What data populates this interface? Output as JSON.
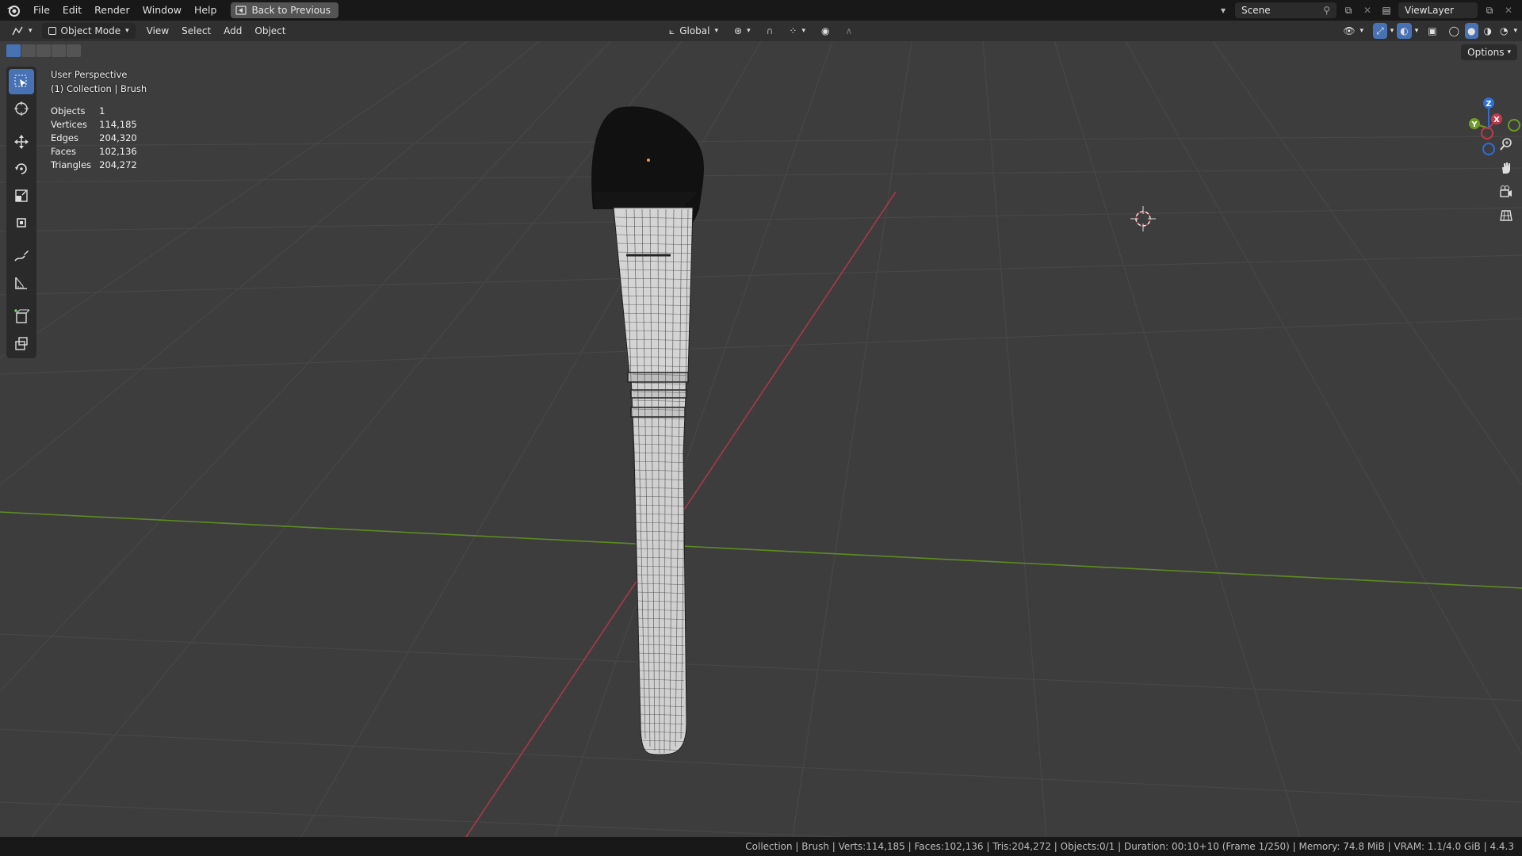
{
  "menubar": {
    "items": [
      "File",
      "Edit",
      "Render",
      "Window",
      "Help"
    ],
    "back_button": "Back to Previous",
    "scene": "Scene",
    "view_layer": "ViewLayer"
  },
  "header": {
    "mode": "Object Mode",
    "menus": [
      "View",
      "Select",
      "Add",
      "Object"
    ],
    "transform_orientation": "Global",
    "options": "Options"
  },
  "viewport": {
    "view_name": "User Perspective",
    "collection_label": "(1) Collection | Brush",
    "stats": [
      {
        "label": "Objects",
        "value": "1"
      },
      {
        "label": "Vertices",
        "value": "114,185"
      },
      {
        "label": "Edges",
        "value": "204,320"
      },
      {
        "label": "Faces",
        "value": "102,136"
      },
      {
        "label": "Triangles",
        "value": "204,272"
      }
    ],
    "gizmo_axes": {
      "x": "X",
      "y": "Y",
      "z": "Z"
    }
  },
  "statusbar": {
    "text": "Collection | Brush | Verts:114,185 | Faces:102,136 | Tris:204,272 | Objects:0/1 | Duration: 00:10+10 (Frame 1/250) | Memory: 74.8 MiB | VRAM: 1.1/4.0 GiB | 4.4.3"
  },
  "colors": {
    "accent": "#4772b3",
    "x_axis": "#c0394b",
    "y_axis": "#6e9a26",
    "z_axis": "#2f6fd6"
  },
  "icons": [
    "blender-logo",
    "editor-type-icon",
    "object-mode-icon",
    "select-box-icon",
    "cursor-icon",
    "move-icon",
    "rotate-icon",
    "scale-icon",
    "transform-icon",
    "annotate-icon",
    "measure-icon",
    "add-cube-icon",
    "extrude-icon",
    "zoom-icon",
    "hand-icon",
    "camera-icon",
    "grid-icon"
  ]
}
